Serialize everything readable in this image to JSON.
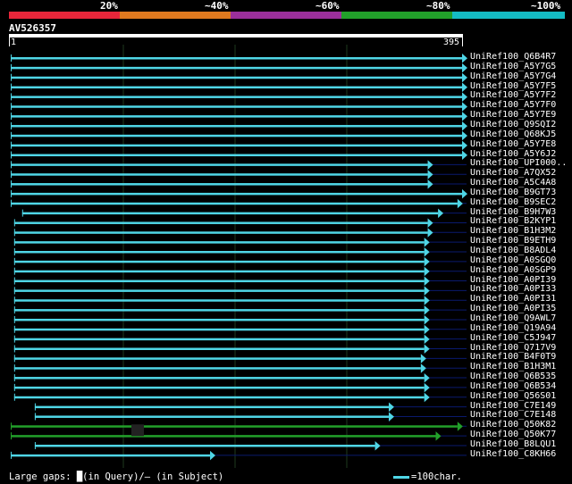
{
  "scale": {
    "labels": [
      "20%",
      "~40%",
      "~60%",
      "~80%",
      "~100%"
    ],
    "colors": [
      "#e8263a",
      "#e07a1f",
      "#9b2f9b",
      "#22a02a",
      "#14bcc4"
    ]
  },
  "query": {
    "name": "AV526357",
    "start": "1",
    "end": "395"
  },
  "colors": {
    "hit": "#4fd6e6",
    "green": "#22a02a",
    "line": "#0a1a6e",
    "grid": "#1e3a1e"
  },
  "hits": [
    {
      "label": "UniRef100_Q6B4R7",
      "s": 1,
      "e": 395,
      "c": "cyan"
    },
    {
      "label": "UniRef100_A5Y7G5",
      "s": 1,
      "e": 395,
      "c": "cyan"
    },
    {
      "label": "UniRef100_A5Y7G4",
      "s": 1,
      "e": 395,
      "c": "cyan"
    },
    {
      "label": "UniRef100_A5Y7F5",
      "s": 1,
      "e": 395,
      "c": "cyan"
    },
    {
      "label": "UniRef100_A5Y7F2",
      "s": 1,
      "e": 395,
      "c": "cyan"
    },
    {
      "label": "UniRef100_A5Y7F0",
      "s": 1,
      "e": 395,
      "c": "cyan"
    },
    {
      "label": "UniRef100_A5Y7E9",
      "s": 1,
      "e": 395,
      "c": "cyan"
    },
    {
      "label": "UniRef100_Q9SQI2",
      "s": 1,
      "e": 395,
      "c": "cyan"
    },
    {
      "label": "UniRef100_Q68KJ5",
      "s": 1,
      "e": 395,
      "c": "cyan"
    },
    {
      "label": "UniRef100_A5Y7E8",
      "s": 1,
      "e": 395,
      "c": "cyan"
    },
    {
      "label": "UniRef100_A5Y6J2",
      "s": 1,
      "e": 395,
      "c": "cyan"
    },
    {
      "label": "UniRef100_UPI000..",
      "s": 1,
      "e": 365,
      "c": "cyan"
    },
    {
      "label": "UniRef100_A7QX52",
      "s": 1,
      "e": 365,
      "c": "cyan"
    },
    {
      "label": "UniRef100_A5C4A8",
      "s": 1,
      "e": 365,
      "c": "cyan"
    },
    {
      "label": "UniRef100_B9GT73",
      "s": 1,
      "e": 395,
      "c": "cyan"
    },
    {
      "label": "UniRef100_B9SEC2",
      "s": 1,
      "e": 391,
      "c": "cyan"
    },
    {
      "label": "UniRef100_B9H7W3",
      "s": 11,
      "e": 374,
      "c": "cyan"
    },
    {
      "label": "UniRef100_B2KYP1",
      "s": 4,
      "e": 365,
      "c": "cyan"
    },
    {
      "label": "UniRef100_B1H3M2",
      "s": 4,
      "e": 365,
      "c": "cyan"
    },
    {
      "label": "UniRef100_B9ETH9",
      "s": 4,
      "e": 362,
      "c": "cyan"
    },
    {
      "label": "UniRef100_B8ADL4",
      "s": 4,
      "e": 362,
      "c": "cyan"
    },
    {
      "label": "UniRef100_A0SGQ0",
      "s": 4,
      "e": 362,
      "c": "cyan"
    },
    {
      "label": "UniRef100_A0SGP9",
      "s": 4,
      "e": 362,
      "c": "cyan"
    },
    {
      "label": "UniRef100_A0PI39",
      "s": 4,
      "e": 362,
      "c": "cyan"
    },
    {
      "label": "UniRef100_A0PI33",
      "s": 4,
      "e": 362,
      "c": "cyan"
    },
    {
      "label": "UniRef100_A0PI31",
      "s": 4,
      "e": 362,
      "c": "cyan"
    },
    {
      "label": "UniRef100_A0PI35",
      "s": 4,
      "e": 362,
      "c": "cyan"
    },
    {
      "label": "UniRef100_Q9AWL7",
      "s": 4,
      "e": 362,
      "c": "cyan"
    },
    {
      "label": "UniRef100_Q19A94",
      "s": 4,
      "e": 362,
      "c": "cyan"
    },
    {
      "label": "UniRef100_C5J947",
      "s": 4,
      "e": 362,
      "c": "cyan"
    },
    {
      "label": "UniRef100_Q717V9",
      "s": 4,
      "e": 362,
      "c": "cyan"
    },
    {
      "label": "UniRef100_B4F0T9",
      "s": 4,
      "e": 359,
      "c": "cyan"
    },
    {
      "label": "UniRef100_B1H3M1",
      "s": 4,
      "e": 359,
      "c": "cyan"
    },
    {
      "label": "UniRef100_Q6B535",
      "s": 4,
      "e": 362,
      "c": "cyan"
    },
    {
      "label": "UniRef100_Q6B534",
      "s": 4,
      "e": 362,
      "c": "cyan"
    },
    {
      "label": "UniRef100_Q56S01",
      "s": 4,
      "e": 362,
      "c": "cyan"
    },
    {
      "label": "UniRef100_C7E149",
      "s": 22,
      "e": 331,
      "c": "cyan"
    },
    {
      "label": "UniRef100_C7E148",
      "s": 22,
      "e": 331,
      "c": "cyan"
    },
    {
      "label": "UniRef100_Q50K82",
      "s": 1,
      "e": 391,
      "c": "green"
    },
    {
      "label": "UniRef100_Q50K77",
      "s": 1,
      "e": 372,
      "c": "green"
    },
    {
      "label": "UniRef100_B8LQU1",
      "s": 22,
      "e": 319,
      "c": "cyan"
    },
    {
      "label": "UniRef100_C8KH66",
      "s": 1,
      "e": 175,
      "c": "cyan"
    }
  ],
  "legend": {
    "text": "Large gaps: █(in Query)/– (in Subject)",
    "scale_text": "=100char."
  }
}
